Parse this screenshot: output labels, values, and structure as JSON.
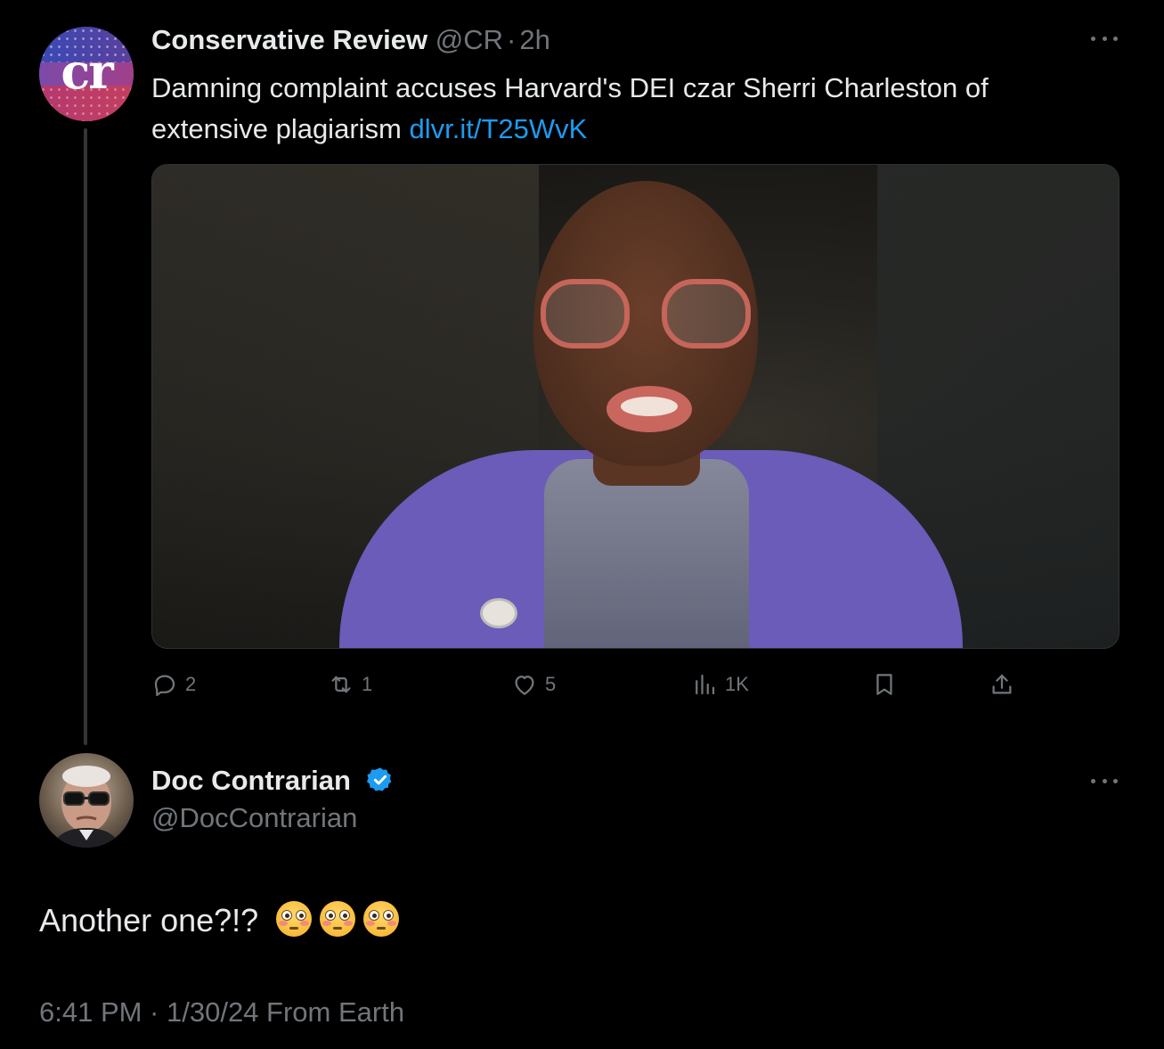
{
  "post": {
    "author_name": "Conservative Review",
    "author_handle": "@CR",
    "separator": "·",
    "time_ago": "2h",
    "avatar_text": "cr",
    "text": "Damning complaint accuses Harvard's DEI czar Sherri Charleston of extensive plagiarism",
    "link_text": "dlvr.it/T25WvK",
    "actions": {
      "reply_count": "2",
      "repost_count": "1",
      "like_count": "5",
      "view_count": "1K"
    }
  },
  "reply": {
    "author_name": "Doc Contrarian",
    "author_handle": "@DocContrarian",
    "verified": true,
    "text": "Another one?!?",
    "emoji_name": "flushed-face",
    "emoji_count": 3,
    "timestamp": "6:41 PM · 1/30/24 From Earth"
  },
  "colors": {
    "background": "#000000",
    "text": "#e7e9ea",
    "muted": "#71767b",
    "link": "#1d9bf0",
    "thread_line": "#333639"
  },
  "icons": [
    "reply-icon",
    "repost-icon",
    "like-icon",
    "views-icon",
    "bookmark-icon",
    "share-icon",
    "more-icon",
    "verified-badge-icon"
  ]
}
